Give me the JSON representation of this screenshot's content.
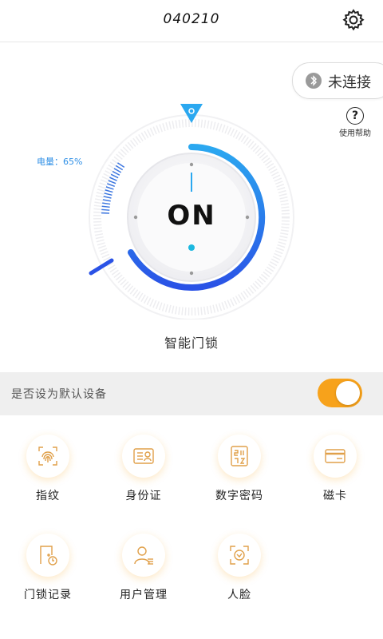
{
  "header": {
    "device_id": "040210"
  },
  "bluetooth": {
    "status_label": "未连接"
  },
  "help": {
    "icon_glyph": "?",
    "label": "使用帮助"
  },
  "battery": {
    "label": "电量：65%",
    "level_percent": 65
  },
  "dial": {
    "state_text": "ON"
  },
  "lock": {
    "title": "智能门锁"
  },
  "default_device": {
    "label": "是否设为默认设备",
    "enabled": true
  },
  "accent_color": "#f7a21b",
  "features": [
    {
      "label": "指纹",
      "icon": "fingerprint-icon"
    },
    {
      "label": "身份证",
      "icon": "id-card-icon"
    },
    {
      "label": "数字密码",
      "icon": "passcode-icon"
    },
    {
      "label": "磁卡",
      "icon": "card-icon"
    },
    {
      "label": "门锁记录",
      "icon": "door-record-icon"
    },
    {
      "label": "用户管理",
      "icon": "user-management-icon"
    },
    {
      "label": "人脸",
      "icon": "face-icon"
    }
  ]
}
